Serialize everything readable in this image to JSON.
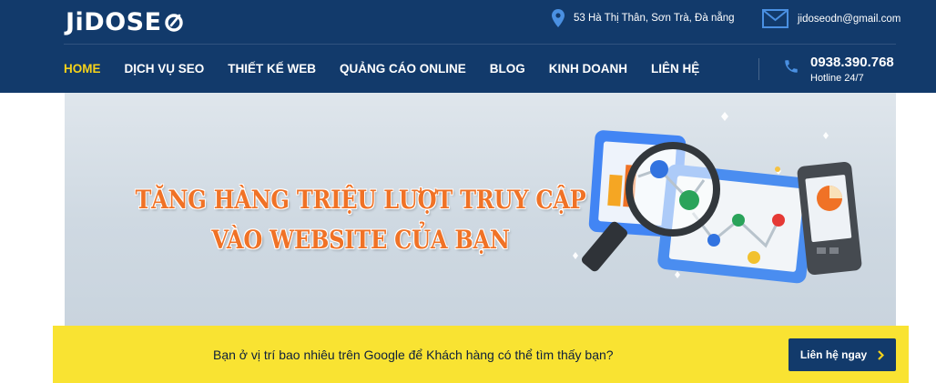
{
  "header": {
    "logo_text": "JiDOSE",
    "address": "53 Hà Thị Thân, Sơn Trà, Đà nẵng",
    "email": "jidoseodn@gmail.com",
    "nav": [
      {
        "label": "HOME",
        "active": true
      },
      {
        "label": "DỊCH VỤ SEO"
      },
      {
        "label": "THIẾT KẾ WEB"
      },
      {
        "label": "QUẢNG CÁO ONLINE"
      },
      {
        "label": "BLOG"
      },
      {
        "label": "KINH DOANH"
      },
      {
        "label": "LIÊN HỆ"
      }
    ],
    "hotline_phone": "0938.390.768",
    "hotline_label": "Hotline 24/7"
  },
  "banner": {
    "headline_line1": "TĂNG HÀNG TRIỆU LƯỢT TRUY CẬP",
    "headline_line2": "VÀO WEBSITE CỦA BẠN",
    "icons": [
      "magnifier-icon",
      "laptop-chart-icon",
      "tablet-chart-icon",
      "phone-pie-icon"
    ]
  },
  "cta": {
    "text": "Bạn ở vị trí bao nhiêu trên Google để Khách hàng có thể tìm thấy bạn?",
    "button_label": "Liên hệ ngay"
  },
  "colors": {
    "header_bg": "#123a6b",
    "nav_active": "#f5d21a",
    "headline": "#f07226",
    "cta_bg": "#f9e332",
    "cta_button": "#123a6b"
  }
}
